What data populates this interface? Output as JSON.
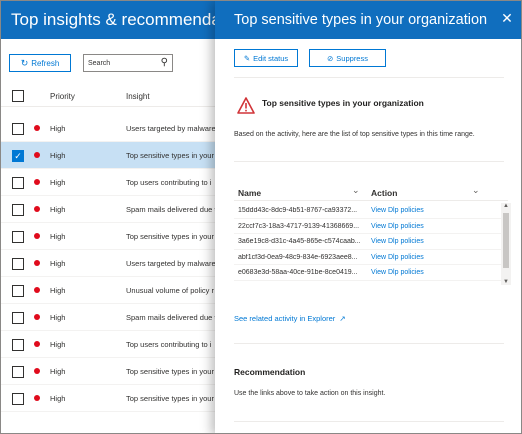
{
  "background_panel": {
    "title": "Top insights & recommendations",
    "refresh_label": "Refresh",
    "search_placeholder": "Search",
    "columns": {
      "priority": "Priority",
      "insight": "Insight"
    },
    "rows": [
      {
        "priority": "High",
        "insight": "Users targeted by malware",
        "selected": false
      },
      {
        "priority": "High",
        "insight": "Top sensitive types in your",
        "selected": true
      },
      {
        "priority": "High",
        "insight": "Top users contributing to i",
        "selected": false
      },
      {
        "priority": "High",
        "insight": "Spam mails delivered due t",
        "selected": false
      },
      {
        "priority": "High",
        "insight": "Top sensitive types in your",
        "selected": false
      },
      {
        "priority": "High",
        "insight": "Users targeted by malware",
        "selected": false
      },
      {
        "priority": "High",
        "insight": "Unusual volume of policy r",
        "selected": false
      },
      {
        "priority": "High",
        "insight": "Spam mails delivered due t",
        "selected": false
      },
      {
        "priority": "High",
        "insight": "Top users contributing to i",
        "selected": false
      },
      {
        "priority": "High",
        "insight": "Top sensitive types in your",
        "selected": false
      },
      {
        "priority": "High",
        "insight": "Top sensitive types in your",
        "selected": false
      }
    ]
  },
  "flyout": {
    "title": "Top sensitive types in your organization",
    "edit_status_label": "Edit status",
    "suppress_label": "Suppress",
    "section_title": "Top sensitive types in your organization",
    "description": "Based on the activity, here are the list of top sensitive types in this time range.",
    "table": {
      "col_name": "Name",
      "col_action": "Action",
      "rows": [
        {
          "name": "15ddd43c-8dc9-4b51-8767-ca93372...",
          "action": "View Dlp policies"
        },
        {
          "name": "22ccf7c3-18a3-4717-9139-41368669...",
          "action": "View Dlp policies"
        },
        {
          "name": "3a6e19c8-d31c-4a45-865e-c574caab...",
          "action": "View Dlp policies"
        },
        {
          "name": "abf1cf3d-0ea9-48c9-834e-6923aee8...",
          "action": "View Dlp policies"
        },
        {
          "name": "e0683e3d-58aa-40ce-91be-8ce0419...",
          "action": "View Dlp policies"
        }
      ]
    },
    "explorer_link": "See related activity in Explorer",
    "recommendation_title": "Recommendation",
    "recommendation_text": "Use the links above to take action on this insight."
  },
  "colors": {
    "accent": "#106ebe",
    "link": "#0078d4",
    "priority_dot": "#e00b1c",
    "warning": "#d13438",
    "selected_row": "#c7e0f4"
  }
}
